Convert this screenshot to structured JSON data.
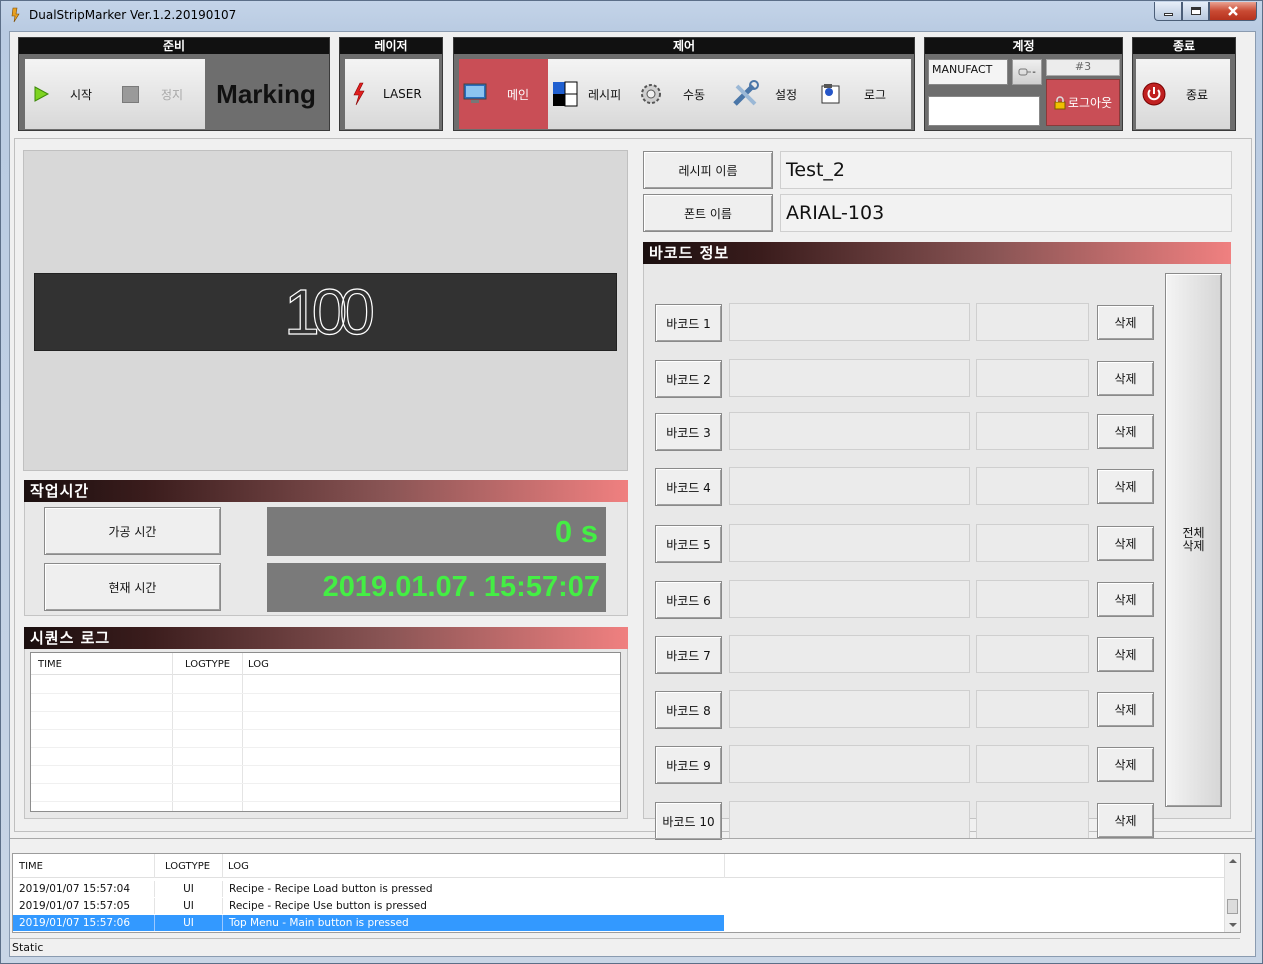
{
  "window": {
    "title": "DualStripMarker Ver.1.2.20190107"
  },
  "colors": {
    "accent_red": "#c94e56",
    "green_text": "#44ee44",
    "section_gradient_end": "#f08080"
  },
  "toolbar": {
    "prepare": {
      "header": "준비",
      "start_label": "시작",
      "stop_label": "정지",
      "status_text": "Marking"
    },
    "laser": {
      "header": "레이저",
      "laser_label": "LASER"
    },
    "control": {
      "header": "제어",
      "main_label": "메인",
      "recipe_label": "레시피",
      "manual_label": "수동",
      "settings_label": "설정",
      "log_label": "로그"
    },
    "account": {
      "header": "계정",
      "user_name": "MANUFACT",
      "level": "#3",
      "logout_label": "로그아웃",
      "key_label": "-"
    },
    "exit": {
      "header": "종료",
      "exit_label": "종료"
    }
  },
  "marking_preview": {
    "text": "100"
  },
  "work_time": {
    "header": "작업시간",
    "process_label": "가공 시간",
    "process_value": "0 s",
    "current_label": "현재 시간",
    "current_value": "2019.01.07. 15:57:07"
  },
  "sequence_log": {
    "header": "시퀀스 로그",
    "columns": [
      "TIME",
      "LOGTYPE",
      "LOG"
    ]
  },
  "recipe_info": {
    "recipe_label": "레시피 이름",
    "recipe_value": "Test_2",
    "font_label": "폰트 이름",
    "font_value": "ARIAL-103"
  },
  "barcode": {
    "header": "바코드 정보",
    "delete_label": "삭제",
    "delete_all_label": "전체\n삭제",
    "items": [
      {
        "label": "바코드 1"
      },
      {
        "label": "바코드 2"
      },
      {
        "label": "바코드 3"
      },
      {
        "label": "바코드 4"
      },
      {
        "label": "바코드 5"
      },
      {
        "label": "바코드 6"
      },
      {
        "label": "바코드 7"
      },
      {
        "label": "바코드 8"
      },
      {
        "label": "바코드 9"
      },
      {
        "label": "바코드 10"
      }
    ]
  },
  "bottom_log": {
    "columns": [
      "TIME",
      "LOGTYPE",
      "LOG"
    ],
    "rows": [
      {
        "time": "2019/01/07 15:57:04",
        "type": "UI",
        "log": "Recipe - Recipe Load button is pressed"
      },
      {
        "time": "2019/01/07 15:57:05",
        "type": "UI",
        "log": "Recipe - Recipe Use button is pressed"
      },
      {
        "time": "2019/01/07 15:57:06",
        "type": "UI",
        "log": "Top Menu - Main button is pressed"
      }
    ]
  },
  "status_bar": {
    "text": "Static"
  }
}
